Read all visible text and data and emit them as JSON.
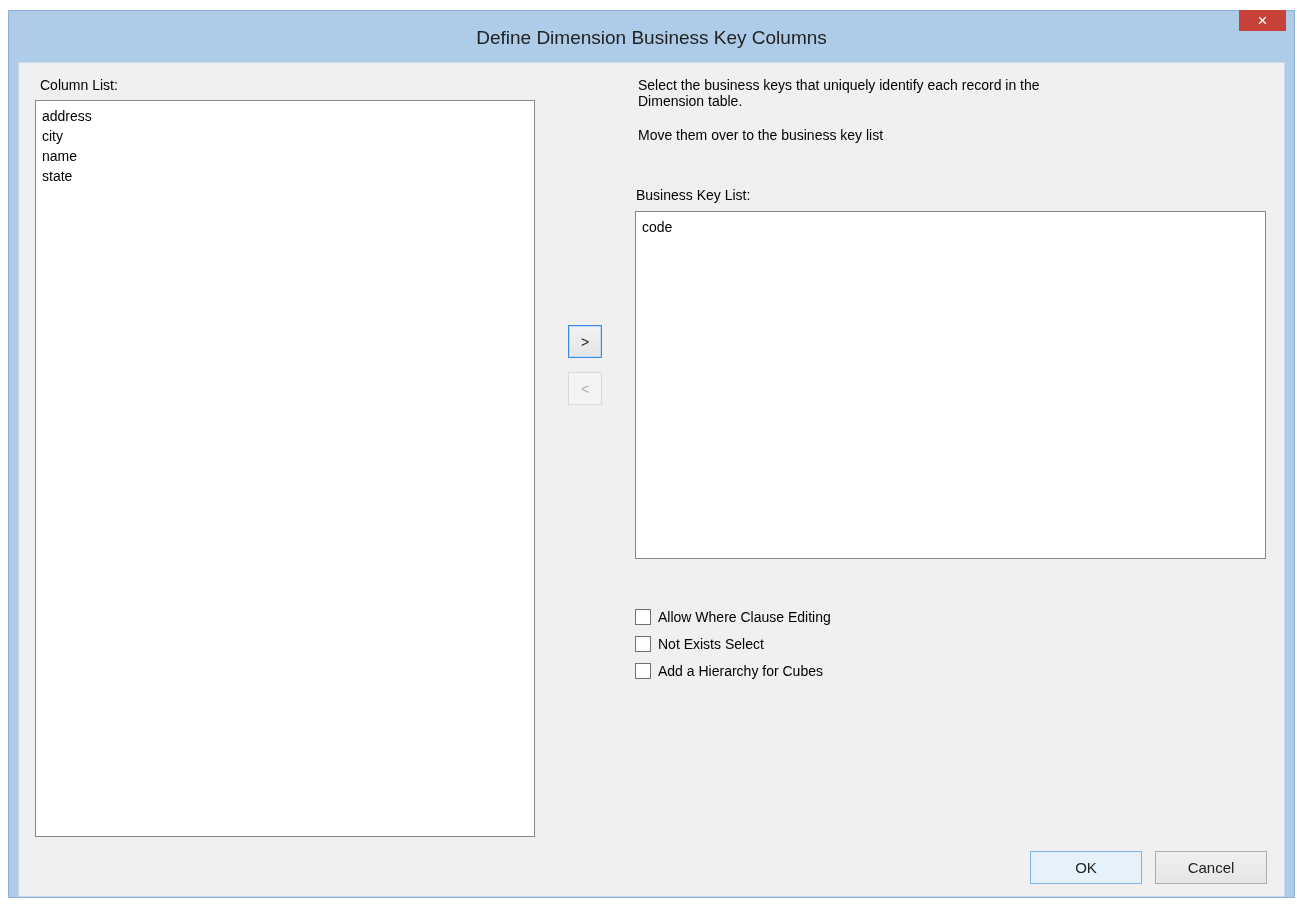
{
  "window": {
    "title": "Define Dimension Business Key Columns",
    "close": "×"
  },
  "column_list": {
    "label": "Column List:",
    "items": [
      {
        "text": "address",
        "selected": false
      },
      {
        "text": "city",
        "selected": false
      },
      {
        "text": "name",
        "selected": false
      },
      {
        "text": "state",
        "selected": false
      }
    ]
  },
  "move_buttons": [
    {
      "label": ">",
      "disabled": false,
      "focused": true
    },
    {
      "label": "<",
      "disabled": true,
      "focused": false
    }
  ],
  "instructions": [
    "Select the business keys that uniquely identify each record in the Dimension table.",
    "Move them over to the business key list"
  ],
  "business_key_list": {
    "label": "Business Key List:",
    "items": [
      {
        "text": "code",
        "selected": false
      }
    ]
  },
  "options": [
    {
      "label": "Allow Where Clause Editing",
      "checked": false
    },
    {
      "label": "Not Exists Select",
      "checked": false
    },
    {
      "label": "Add a Hierarchy for Cubes",
      "checked": false
    }
  ],
  "buttons": [
    {
      "label": "OK",
      "default": true
    },
    {
      "label": "Cancel",
      "default": false
    }
  ]
}
